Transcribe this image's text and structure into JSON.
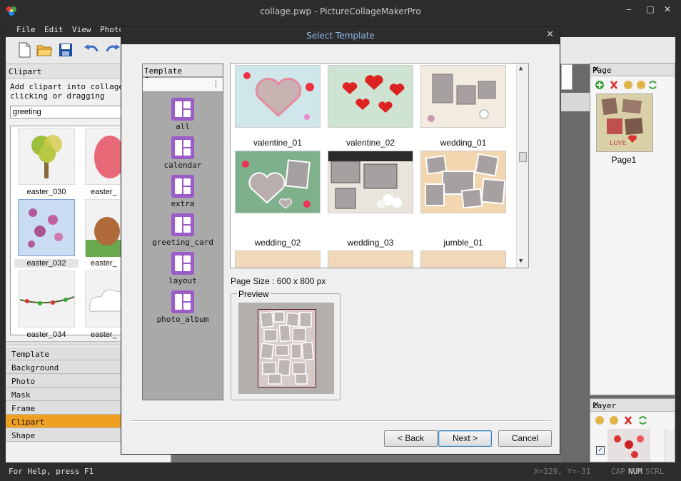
{
  "window": {
    "title": "collage.pwp - PictureCollageMakerPro",
    "minimize": "‒",
    "maximize": "□",
    "close": "✕"
  },
  "menu": [
    "File",
    "Edit",
    "View",
    "Photo"
  ],
  "toolbar_icons": [
    "new-file-icon",
    "open-folder-icon",
    "save-icon",
    "undo-icon",
    "redo-icon"
  ],
  "clipart": {
    "title": "Clipart",
    "desc_line1": "Add clipart into collage b",
    "desc_line2": "clicking or dragging",
    "category": "greeting",
    "items": [
      "easter_030",
      "easter_",
      "easter_032",
      "easter_",
      "easter_034",
      "easter_"
    ]
  },
  "left_tabs": [
    "Template",
    "Background",
    "Photo",
    "Mask",
    "Frame",
    "Clipart",
    "Shape"
  ],
  "active_left_tab": "Clipart",
  "page_panel": {
    "title": "Page",
    "close": "✕",
    "page_label": "Page1",
    "thumb_text": "LOVE"
  },
  "layer_panel": {
    "title": "Layer",
    "close": "✕",
    "checkbox": "✓"
  },
  "status": {
    "help": "For Help, press F1",
    "coords": "X=329, Y=-31",
    "caps": "CAP",
    "num": "NUM",
    "scrl": "SCRL"
  },
  "dialog": {
    "title": "Select Template",
    "close": "✕",
    "category_header": "Template Category",
    "categories": [
      "all",
      "calendar",
      "extra",
      "greeting_card",
      "layout",
      "photo_album"
    ],
    "templates": [
      "valentine_01",
      "valentine_02",
      "wedding_01",
      "wedding_02",
      "wedding_03",
      "jumble_01"
    ],
    "page_size": "Page Size : 600 x 800 px",
    "preview_label": "Preview",
    "back": "< Back",
    "next": "Next >",
    "cancel": "Cancel"
  },
  "colors": {
    "accent_tab": "#f0a020",
    "category_icon": "#9b5cc8",
    "dialog_title_text": "#8fb8e6"
  }
}
